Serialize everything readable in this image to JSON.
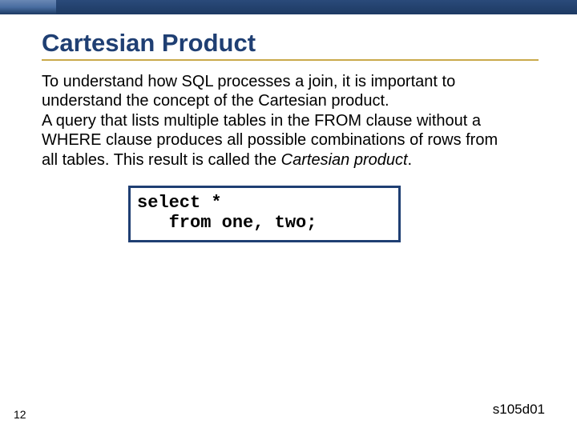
{
  "title": "Cartesian Product",
  "paragraphs": {
    "p1": "To understand how SQL processes a join, it is important to understand the concept of the Cartesian product.",
    "p2_prefix": "A query that lists multiple tables in the FROM clause without a WHERE clause produces all possible combinations of rows from all tables. This result is called the ",
    "p2_em": "Cartesian product",
    "p2_suffix": "."
  },
  "code": "select *\n   from one, two;",
  "page_number": "12",
  "footer_code": "s105d01"
}
